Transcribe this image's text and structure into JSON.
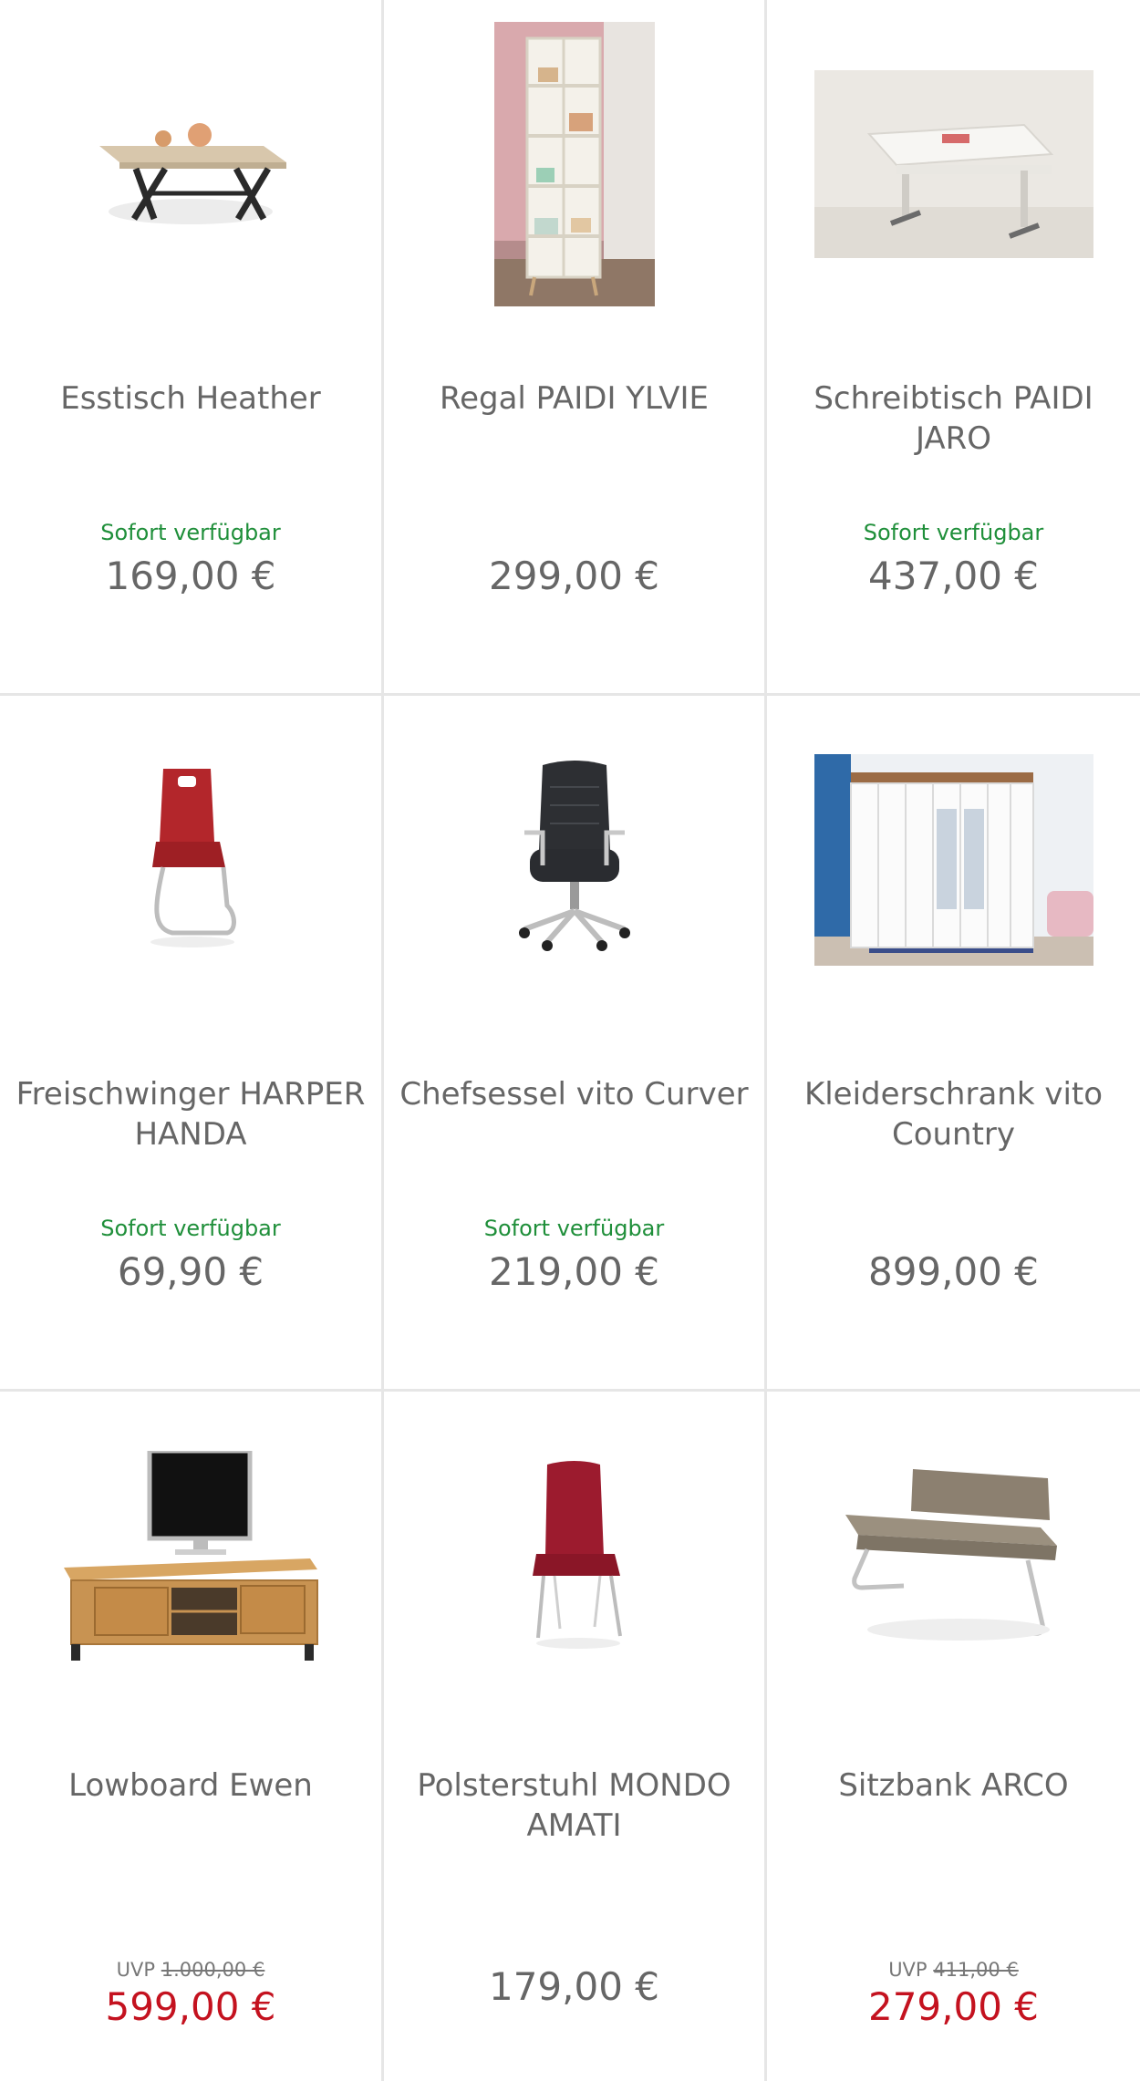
{
  "products": [
    {
      "title": "Esstisch Heather",
      "availability": "Sofort verfügbar",
      "price": "169,00 €",
      "image": "dining-table"
    },
    {
      "title": "Regal PAIDI YLVIE",
      "availability": "",
      "price": "299,00 €",
      "image": "shelf"
    },
    {
      "title": "Schreibtisch PAIDI JARO",
      "availability": "Sofort verfügbar",
      "price": "437,00 €",
      "image": "desk"
    },
    {
      "title": "Freischwinger HARPER HANDA",
      "availability": "Sofort verfügbar",
      "price": "69,90 €",
      "image": "cantilever-chair"
    },
    {
      "title": "Chefsessel vito Curver",
      "availability": "Sofort verfügbar",
      "price": "219,00 €",
      "image": "office-chair"
    },
    {
      "title": "Kleiderschrank vito Country",
      "availability": "",
      "price": "899,00 €",
      "image": "wardrobe"
    },
    {
      "title": "Lowboard Ewen",
      "uvp_label": "UVP",
      "uvp_price": "1.000,00 €",
      "price": "599,00 €",
      "sale": true,
      "image": "lowboard"
    },
    {
      "title": "Polsterstuhl MONDO AMATI",
      "price": "179,00 €",
      "image": "upholstered-chair"
    },
    {
      "title": "Sitzbank ARCO",
      "uvp_label": "UVP",
      "uvp_price": "411,00 €",
      "price": "279,00 €",
      "sale": true,
      "image": "bench"
    }
  ],
  "colors": {
    "availability": "#1f8f3a",
    "sale_price": "#c4121f",
    "text": "#666666",
    "divider": "#e6e6e6"
  }
}
